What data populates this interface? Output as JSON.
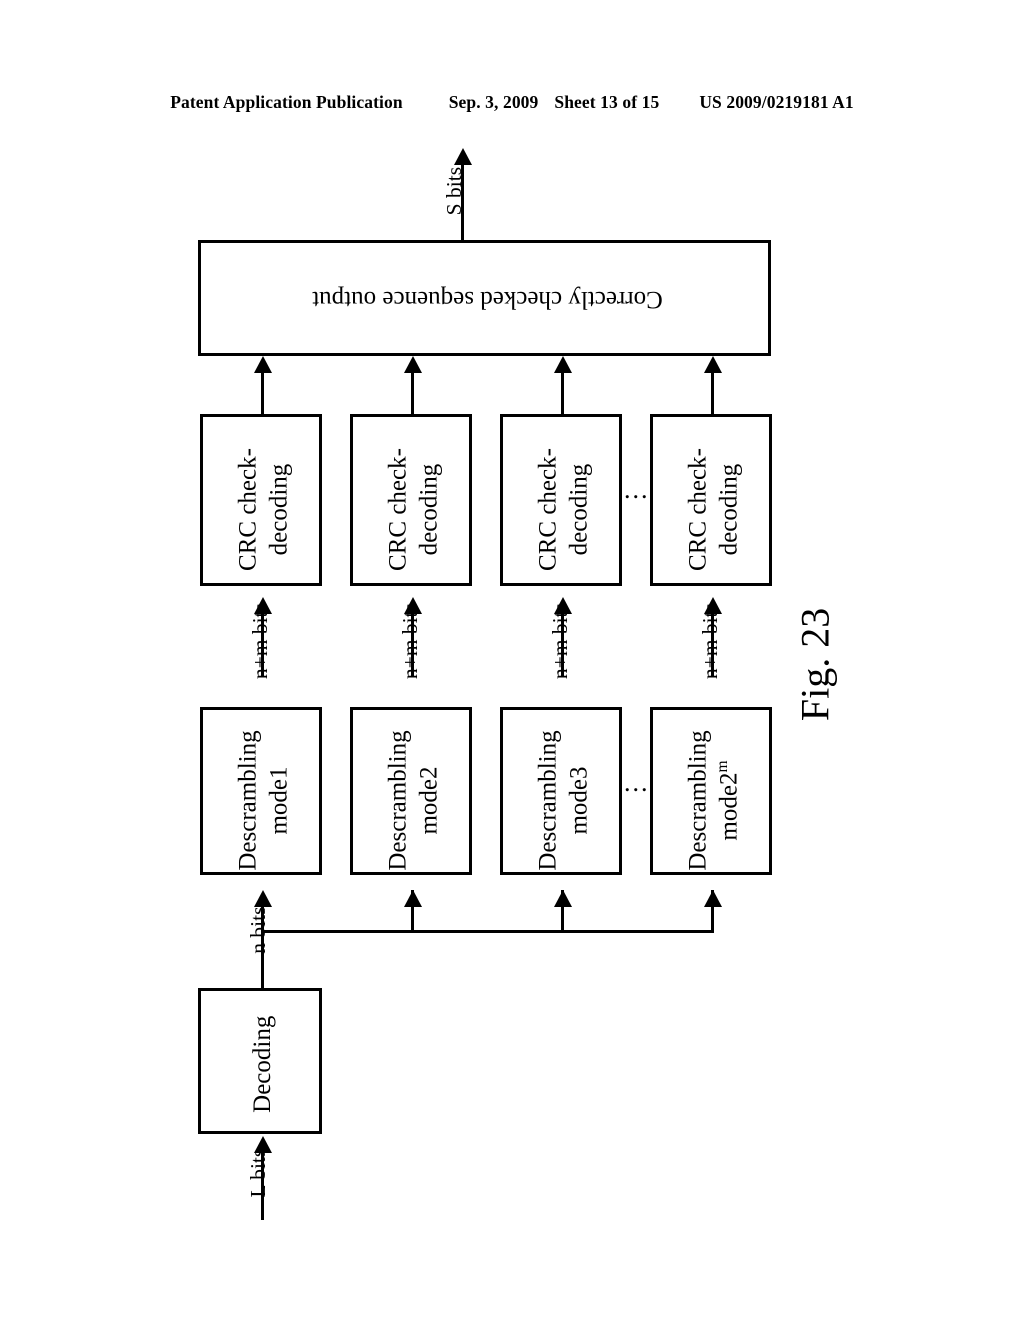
{
  "header": {
    "publication": "Patent Application Publication",
    "date": "Sep. 3, 2009",
    "sheet": "Sheet 13 of 15",
    "patent_number": "US 2009/0219181 A1"
  },
  "figure": {
    "caption": "Fig. 23",
    "output_box": {
      "label": "Correctly checked sequence output"
    },
    "output_signal": {
      "label": "S bits"
    },
    "input_signal": {
      "label": "L bits"
    },
    "decoding_box": {
      "label": "Decoding"
    },
    "bus_signal": {
      "label": "n bits"
    },
    "branch_signal_label": "n+m bits",
    "branches": [
      {
        "descrambling_line1": "Descrambling",
        "descrambling_line2": "mode1",
        "descrambling_superscript": "",
        "crc_line1": "CRC check-",
        "crc_line2": "decoding",
        "bits_label": "n+m bits"
      },
      {
        "descrambling_line1": "Descrambling",
        "descrambling_line2": "mode2",
        "descrambling_superscript": "",
        "crc_line1": "CRC check-",
        "crc_line2": "decoding",
        "bits_label": "n+m bits"
      },
      {
        "descrambling_line1": "Descrambling",
        "descrambling_line2": "mode3",
        "descrambling_superscript": "",
        "crc_line1": "CRC check-",
        "crc_line2": "decoding",
        "bits_label": "n+m bits"
      },
      {
        "descrambling_line1": "Descrambling",
        "descrambling_line2": "mode2",
        "descrambling_superscript": "m",
        "crc_line1": "CRC check-",
        "crc_line2": "decoding",
        "bits_label": "n+m bits"
      }
    ],
    "ellipsis": "..."
  },
  "colors": {
    "ink": "#000000",
    "paper": "#ffffff"
  }
}
